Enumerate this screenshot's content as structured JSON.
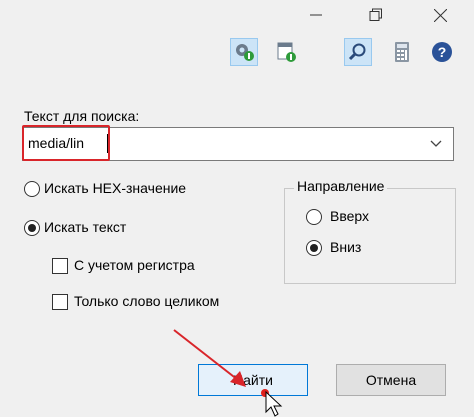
{
  "window": {
    "controls": {
      "minimize_icon": "minimize-icon",
      "restore_icon": "restore-icon",
      "close_icon": "close-icon"
    }
  },
  "toolbar": {
    "items": [
      {
        "name": "settings",
        "icon": "settings-icon",
        "active": true
      },
      {
        "name": "window",
        "icon": "window-icon",
        "active": false
      },
      {
        "name": "search",
        "icon": "search-icon",
        "active": true
      },
      {
        "name": "calculator",
        "icon": "calculator-icon",
        "active": false
      },
      {
        "name": "help",
        "icon": "help-icon",
        "active": false
      }
    ]
  },
  "search": {
    "label": "Текст для поиска:",
    "value": "media/lin"
  },
  "options": {
    "hex_label": "Искать HEX-значение",
    "hex_selected": false,
    "text_label": "Искать текст",
    "text_selected": true,
    "match_case_label": "С учетом регистра",
    "match_case_checked": false,
    "whole_word_label": "Только слово целиком",
    "whole_word_checked": false
  },
  "direction": {
    "legend": "Направление",
    "up_label": "Вверх",
    "up_selected": false,
    "down_label": "Вниз",
    "down_selected": true
  },
  "buttons": {
    "find_label": "Найти",
    "cancel_label": "Отмена"
  },
  "colors": {
    "annotation_red": "#d9252a",
    "accent_blue": "#0078d7"
  }
}
